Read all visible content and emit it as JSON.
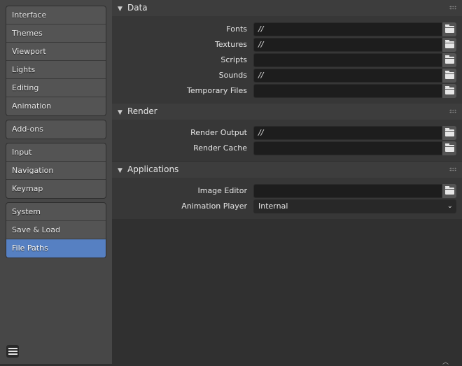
{
  "sidebar": {
    "groups": [
      [
        "Interface",
        "Themes",
        "Viewport",
        "Lights",
        "Editing",
        "Animation"
      ],
      [
        "Add-ons"
      ],
      [
        "Input",
        "Navigation",
        "Keymap"
      ],
      [
        "System",
        "Save & Load",
        "File Paths"
      ]
    ],
    "active": "File Paths",
    "accent": "#5680c2"
  },
  "panels": {
    "data": {
      "title": "Data",
      "rows": [
        {
          "label": "Fonts",
          "value": "//"
        },
        {
          "label": "Textures",
          "value": "//"
        },
        {
          "label": "Scripts",
          "value": ""
        },
        {
          "label": "Sounds",
          "value": "//"
        },
        {
          "label": "Temporary Files",
          "value": ""
        }
      ]
    },
    "render": {
      "title": "Render",
      "rows": [
        {
          "label": "Render Output",
          "value": "//"
        },
        {
          "label": "Render Cache",
          "value": ""
        }
      ]
    },
    "applications": {
      "title": "Applications",
      "image_editor": {
        "label": "Image Editor",
        "value": ""
      },
      "animation_player": {
        "label": "Animation Player",
        "value": "Internal"
      }
    }
  },
  "icons": {
    "collapse": "triangle-down-icon",
    "folder": "folder-icon",
    "menu": "hamburger-menu-icon",
    "grip": "drag-grip-icon"
  }
}
